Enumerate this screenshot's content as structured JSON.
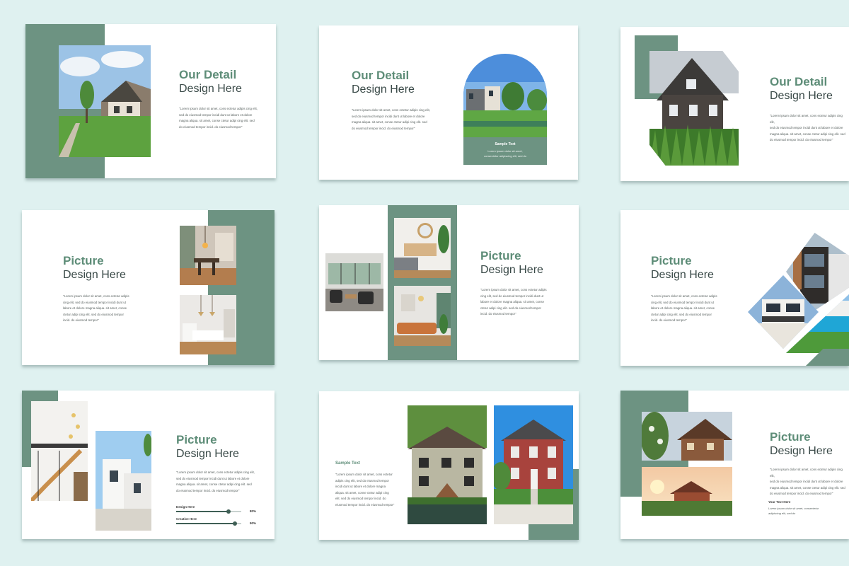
{
  "slides": [
    {
      "title_line1": "Our Detail",
      "title_line2": "Design Here",
      "body": "\"Lorem ipsum dolor sit amet, cons ectetur adipis cing elit,\nsed do eiusmod tempor incidi dunt ut labore et dolore\nmagna aliqua. sit amet, conse ctetur adipi cing elit. sed\ndo eiusmod tempor incid. do eiusmod tempor\""
    },
    {
      "title_line1": "Our Detail",
      "title_line2": "Design Here",
      "body": "\"Lorem ipsum dolor sit amet, cons ectetur adipis cing elit,\nsed do eiusmod tempor incidi dunt ut labore et dolore\nmagna aliqua. sit amet, conse ctetur adipi cing elit. sed\ndo eiusmod tempor incid. do eiusmod tempor\"",
      "caption_title": "Sample Text",
      "caption_body": "Lorem ipsum dolor sit amet,\nconsectetur adipiscing elit, sed do"
    },
    {
      "title_line1": "Our Detail",
      "title_line2": "Design Here",
      "body": "\"Lorem ipsum dolor sit amet, cons ectetur adipis cing elit,\nsed do eiusmod tempor incidi dunt ut labore et dolore\nmagna aliqua. sit amet, conse ctetur adipi cing elit. sed\ndo eiusmod tempor incid. do eiusmod tempor\""
    },
    {
      "title_line1": "Picture",
      "title_line2": "Design Here",
      "body": "\"Lorem ipsum dolor sit amet, cons ectetur adipis\ncing elit, sed do eiusmod tempor incidi dunt ut\nlabore et dolore magna aliqua. sit amet, conse\nctetur adipi cing elit. sed do eiusmod tempor\nincid. do eiusmod tempor\""
    },
    {
      "title_line1": "Picture",
      "title_line2": "Design Here",
      "body": "\"Lorem ipsum dolor sit amet, cons ectetur adipis\ncing elit, sed do eiusmod tempor incidi dunt ut\nlabore et dolore magna aliqua. sit amet, conse\nctetur adipi cing elit. sed do eiusmod tempor\nincid. do eiusmod tempor\""
    },
    {
      "title_line1": "Picture",
      "title_line2": "Design Here",
      "body": "\"Lorem ipsum dolor sit amet, cons ectetur adipis\ncing elit, sed do eiusmod tempor incidi dunt ut\nlabore et dolore magna aliqua. sit amet, conse\nctetur adipi cing elit. sed do eiusmod tempor\nincid. do eiusmod tempor\""
    },
    {
      "title_line1": "Picture",
      "title_line2": "Design Here",
      "body": "\"Lorem ipsum dolor sit amet, cons ectetur adipis cing elit,\nsed do eiusmod tempor incidi dunt ut labore et dolore\nmagna aliqua. sit amet, conse ctetur adipi cing elit. sed\ndo eiusmod tempor incid. do eiusmod tempor\"",
      "bars": [
        {
          "label": "Design Here",
          "value": 80,
          "value_text": "80%"
        },
        {
          "label": "Creative Here",
          "value": 90,
          "value_text": "90%"
        }
      ]
    },
    {
      "sample_title": "Sample Text",
      "body": "\"Lorem ipsum dolor sit amet, cons ectetur\nadipis cing elit, sed do eiusmod tempor\nincidi dunt ut labore et dolore magna\naliqua. sit amet, conse ctetur adipi cing\nelit. sed do eiusmod tempor incid. do\neiusmod tempor incid. do eiusmod tempor\""
    },
    {
      "title_line1": "Picture",
      "title_line2": "Design Here",
      "body": "\"Lorem ipsum dolor sit amet, cons ectetur adipis cing elit,\nsed do eiusmod tempor incidi dunt ut labore et dolore\nmagna aliqua. sit amet, conse ctetur adipi cing elit. sed\ndo eiusmod tempor incid. do eiusmod tempor\"",
      "note_title": "Your Text Here",
      "note_body": "Lorem ipsum dolor sit amet, consectetur\nadipiscing elit, sed do"
    }
  ],
  "colors": {
    "background": "#dff1f0",
    "accent_green": "#6d9382",
    "title_green": "#5e8d78",
    "title_dark": "#3a4a48"
  }
}
